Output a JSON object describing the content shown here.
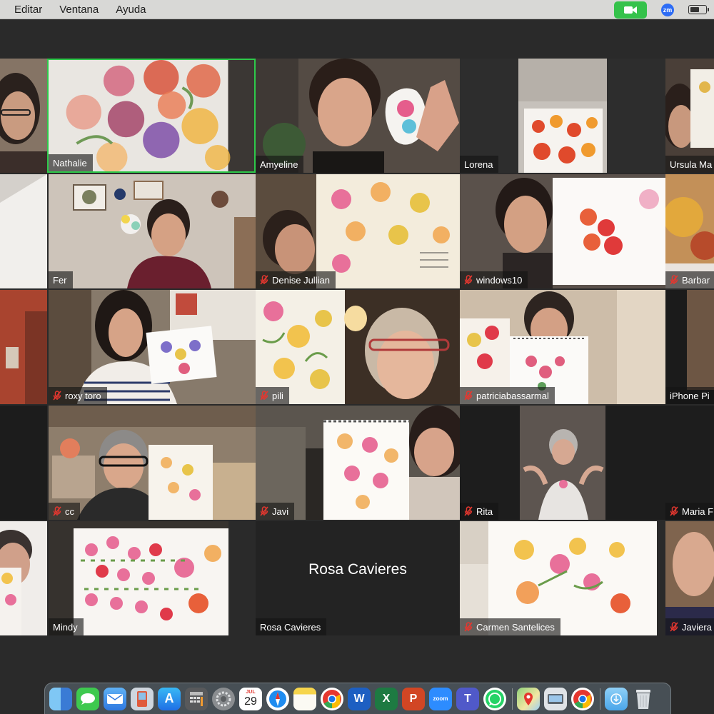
{
  "menu": {
    "items": [
      "Editar",
      "Ventana",
      "Ayuda"
    ],
    "zoom_badge": "zm"
  },
  "participants": [
    {
      "name": "",
      "muted": false
    },
    {
      "name": "Nathalie",
      "muted": false,
      "active": true
    },
    {
      "name": "Amyeline",
      "muted": false
    },
    {
      "name": "Lorena",
      "muted": false
    },
    {
      "name": "Ursula Ma",
      "muted": false
    },
    {
      "name": "",
      "muted": false
    },
    {
      "name": "Fer",
      "muted": false
    },
    {
      "name": "Denise Jullian",
      "muted": true
    },
    {
      "name": "windows10",
      "muted": true
    },
    {
      "name": "Barbar",
      "muted": true
    },
    {
      "name": "",
      "muted": false
    },
    {
      "name": "roxy toro",
      "muted": true
    },
    {
      "name": "pili",
      "muted": true
    },
    {
      "name": "patriciabassarmal",
      "muted": true
    },
    {
      "name": "iPhone Pi",
      "muted": false
    },
    {
      "name": "",
      "muted": false
    },
    {
      "name": "cc",
      "muted": true
    },
    {
      "name": "Javi",
      "muted": true
    },
    {
      "name": "Rita",
      "muted": true
    },
    {
      "name": "Maria F",
      "muted": true
    },
    {
      "name": "",
      "muted": false
    },
    {
      "name": "Mindy",
      "muted": false
    },
    {
      "name": "Rosa Cavieres",
      "muted": false,
      "video_off": true,
      "big_name": "Rosa Cavieres"
    },
    {
      "name": "Carmen Santelices",
      "muted": true
    },
    {
      "name": "Javiera",
      "muted": true
    }
  ],
  "dock": {
    "apps": [
      {
        "name": "finder",
        "label": ""
      },
      {
        "name": "messages",
        "label": ""
      },
      {
        "name": "mail",
        "label": ""
      },
      {
        "name": "preview",
        "label": ""
      },
      {
        "name": "app-store",
        "label": ""
      },
      {
        "name": "calculator",
        "label": ""
      },
      {
        "name": "system-preferences",
        "label": ""
      },
      {
        "name": "calendar",
        "label": "29",
        "month": "JUL"
      },
      {
        "name": "safari",
        "label": ""
      },
      {
        "name": "notes",
        "label": ""
      },
      {
        "name": "chrome",
        "label": ""
      },
      {
        "name": "word",
        "label": "W"
      },
      {
        "name": "excel",
        "label": "X"
      },
      {
        "name": "powerpoint",
        "label": "P"
      },
      {
        "name": "zoom",
        "label": "zoom"
      },
      {
        "name": "teams",
        "label": "T"
      },
      {
        "name": "whatsapp",
        "label": ""
      },
      {
        "name": "maps",
        "label": ""
      },
      {
        "name": "utility",
        "label": ""
      },
      {
        "name": "chrome-2",
        "label": ""
      },
      {
        "name": "downloads-folder",
        "label": ""
      },
      {
        "name": "trash",
        "label": ""
      }
    ]
  }
}
